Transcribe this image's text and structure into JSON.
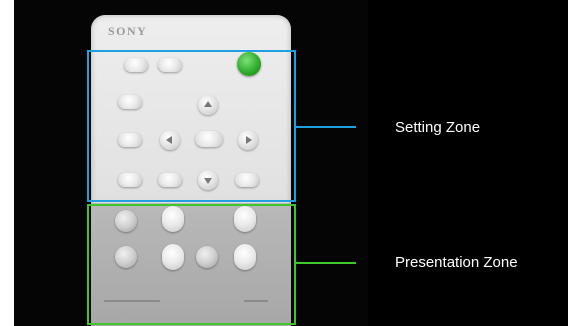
{
  "remote": {
    "brand": "SONY"
  },
  "zones": {
    "setting": {
      "label": "Setting Zone",
      "color": "#1ea0e0"
    },
    "presentation": {
      "label": "Presentation Zone",
      "color": "#3fc62b"
    }
  },
  "icons": [
    "power-icon",
    "arrow-up-icon",
    "arrow-down-icon",
    "arrow-left-icon",
    "arrow-right-icon"
  ]
}
